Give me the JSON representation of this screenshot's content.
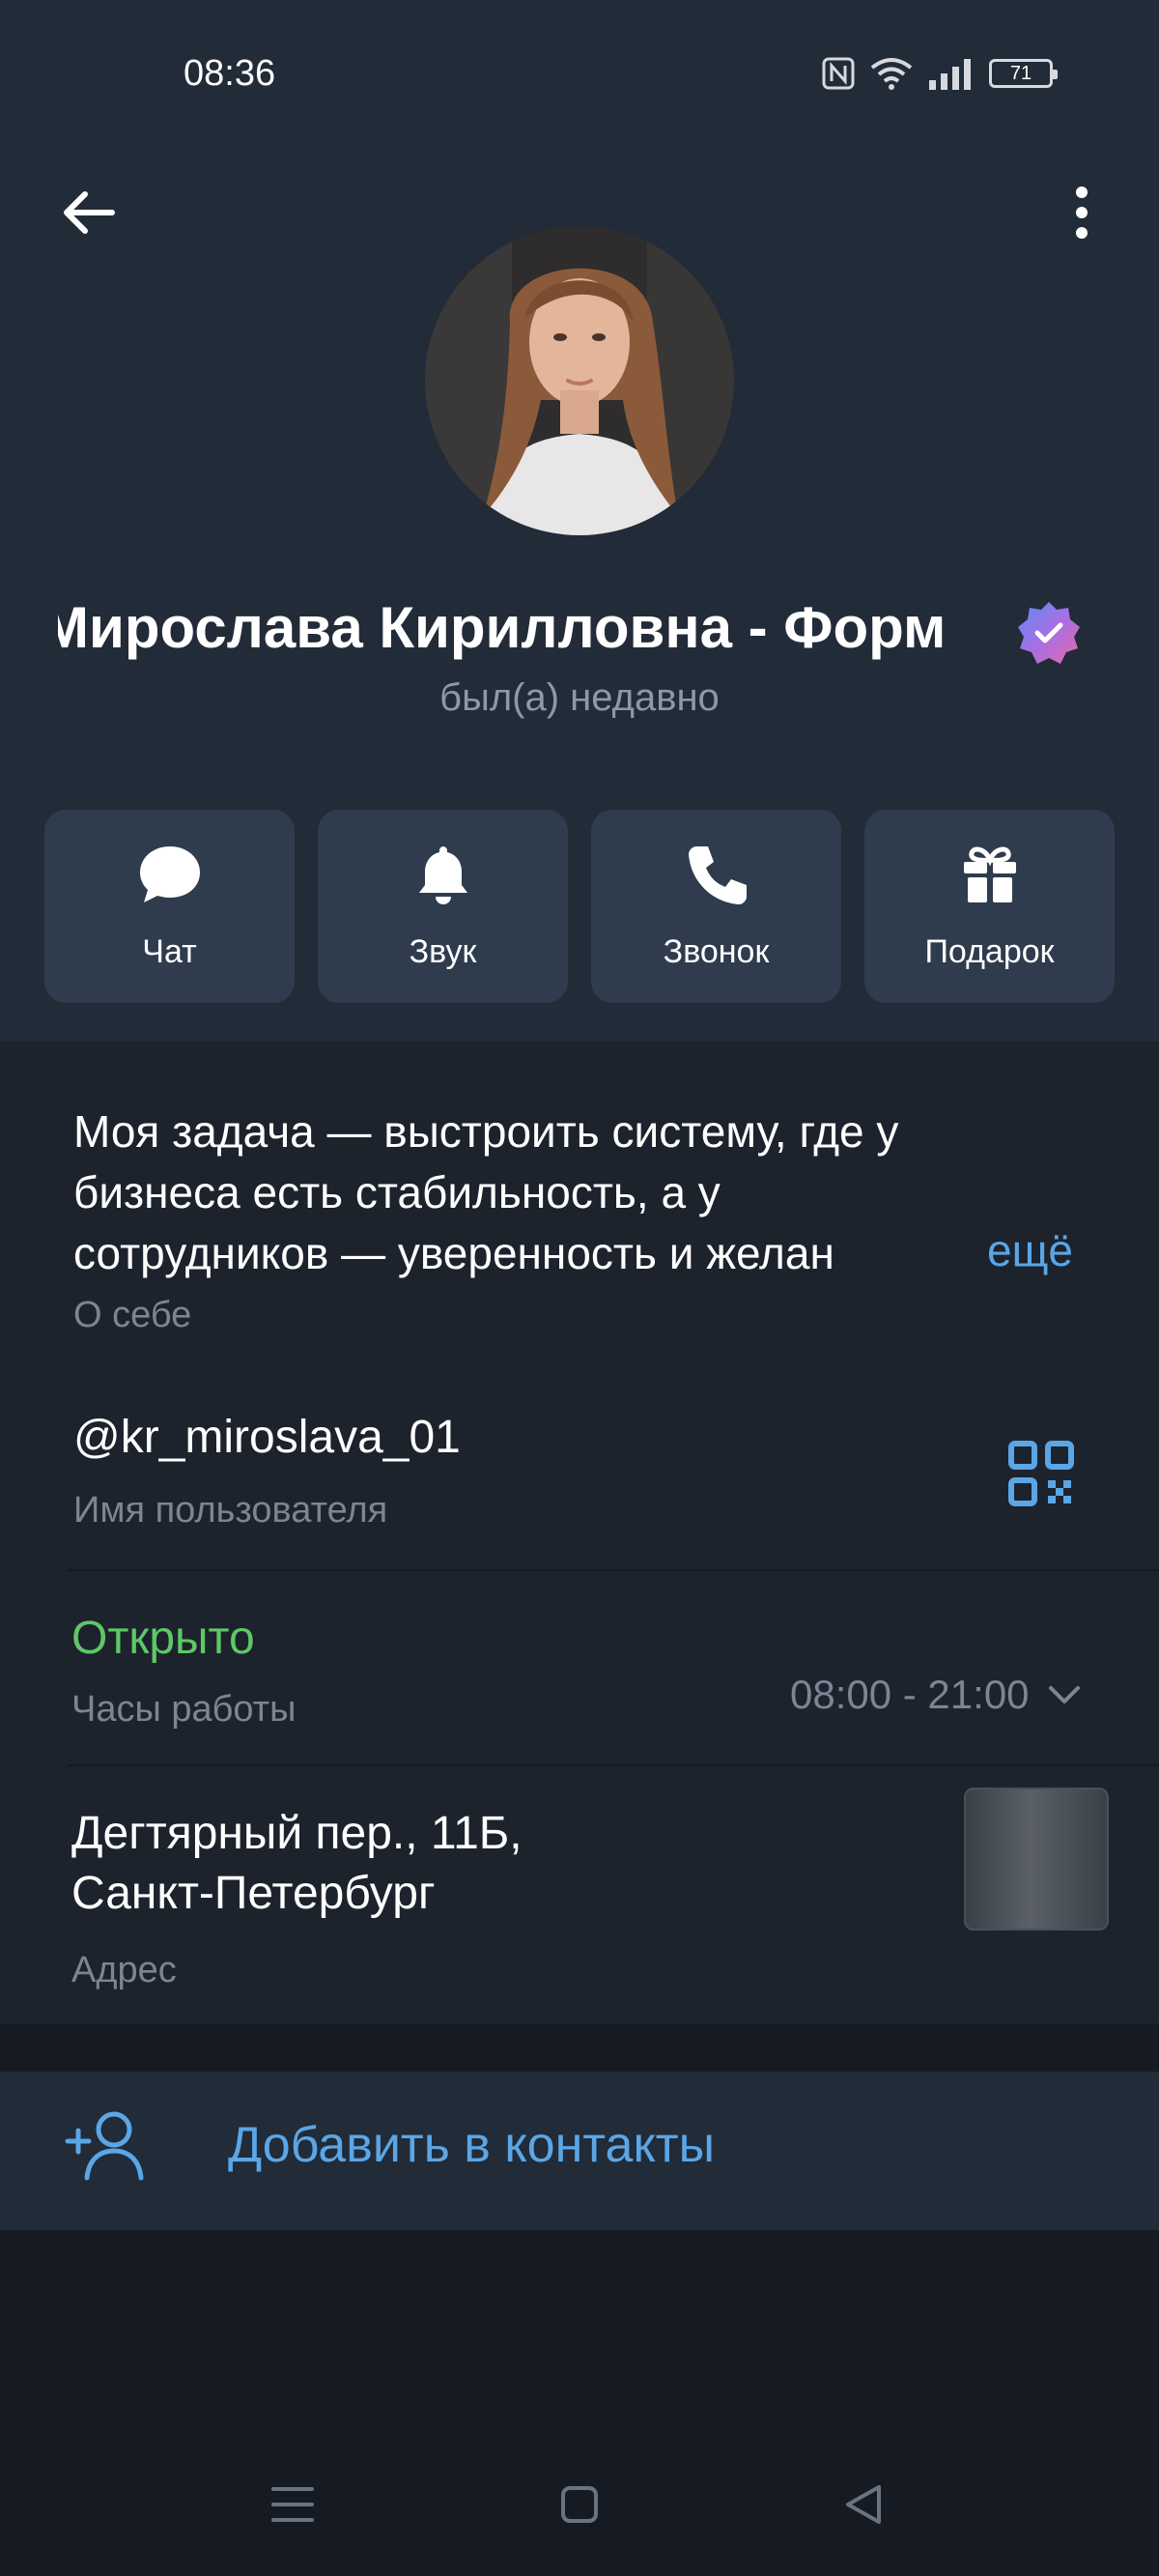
{
  "status_bar": {
    "time": "08:36",
    "battery": "71",
    "icons": [
      "nfc-icon",
      "wifi-icon",
      "signal-icon",
      "battery-icon"
    ]
  },
  "header": {
    "back_icon": "arrow-left-icon",
    "menu_icon": "more-vertical-icon"
  },
  "profile": {
    "name": "Мирослава Кирилловна - Форм",
    "verified_icon": "verified-badge-icon",
    "last_seen": "был(а) недавно"
  },
  "actions": [
    {
      "label": "Чат",
      "icon": "chat-icon"
    },
    {
      "label": "Звук",
      "icon": "bell-icon"
    },
    {
      "label": "Звонок",
      "icon": "phone-icon"
    },
    {
      "label": "Подарок",
      "icon": "gift-icon"
    }
  ],
  "bio": {
    "lines": [
      "Моя задача — выстроить систему, где у",
      "бизнеса есть стабильность, а у",
      "сотрудников — уверенность и желан"
    ],
    "more": "ещё",
    "caption": "О себе"
  },
  "username": {
    "value": "@kr_miroslava_01",
    "caption": "Имя пользователя",
    "icon": "qr-code-icon"
  },
  "business_hours": {
    "status": "Открыто",
    "caption": "Часы работы",
    "hours": "08:00 - 21:00"
  },
  "address": {
    "line1": "Дегтярный пер., 11Б,",
    "line2": "Санкт-Петербург",
    "caption": "Адрес"
  },
  "add_contact": {
    "label": "Добавить в контакты",
    "icon": "add-user-icon"
  },
  "nav_bar": {
    "icons": [
      "recent-apps-icon",
      "home-icon",
      "back-icon"
    ]
  },
  "colors": {
    "header_bg": "#222b38",
    "card_bg": "#1d232d",
    "accent_blue": "#5aa6e6",
    "open_green": "#5fc866",
    "muted_text": "#7b8593"
  }
}
